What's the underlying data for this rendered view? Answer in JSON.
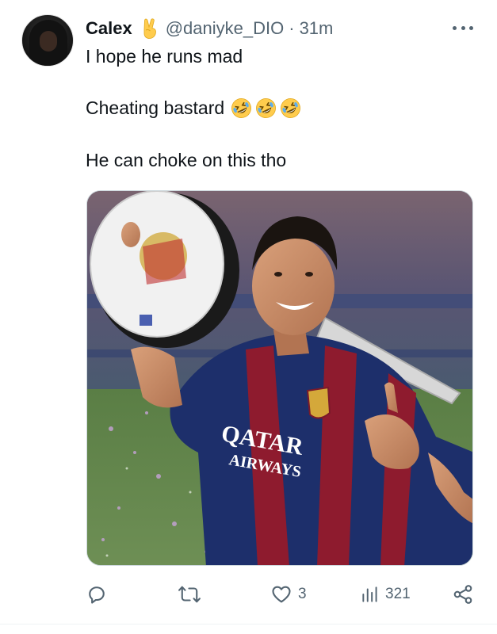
{
  "tweet": {
    "author": {
      "display_name": "Calex",
      "handle": "@daniyke_DIO",
      "badge_emoji": "victory-hand-emoji"
    },
    "separator": "·",
    "time": "31m",
    "lines": [
      "I hope he runs mad",
      "Cheating bastard",
      "He can choke on this tho"
    ],
    "line2_emojis": [
      "rolling-on-floor-laughing",
      "rolling-on-floor-laughing",
      "rolling-on-floor-laughing"
    ],
    "media": {
      "shirt_text_line1": "QATAR",
      "shirt_text_line2": "AIRWAYS"
    },
    "actions": {
      "reply_count": "",
      "retweet_count": "",
      "like_count": "3",
      "views_count": "321"
    }
  },
  "colors": {
    "text_primary": "#0f1419",
    "text_secondary": "#536471",
    "border": "#cfd9de",
    "barca_blue": "#1d2f6b",
    "barca_red": "#8e1b2e"
  }
}
